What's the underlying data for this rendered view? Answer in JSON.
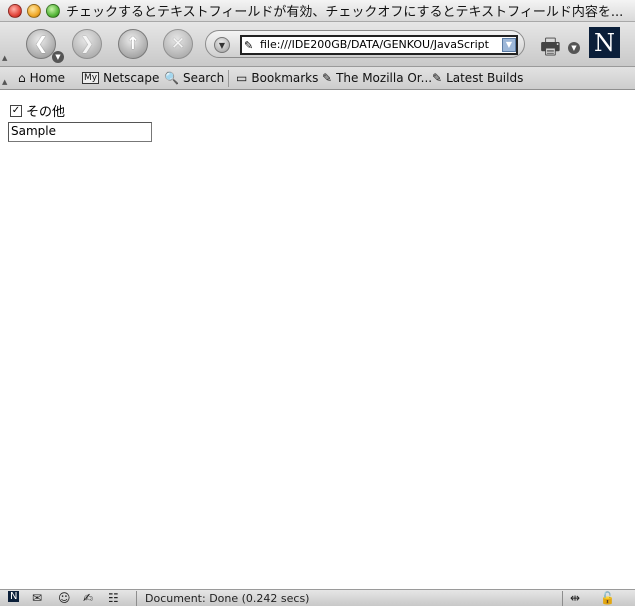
{
  "window": {
    "title": "チェックするとテキストフィールドが有効、チェックオフにするとテキストフィールド内容を..."
  },
  "navbar": {
    "back_icon": "back-arrow-icon",
    "forward_icon": "forward-arrow-icon",
    "reload_icon": "reload-icon",
    "stop_icon": "stop-icon",
    "url": "file:///IDE200GB/DATA/GENKOU/JavaScript"
  },
  "personal_toolbar": {
    "home": "Home",
    "netscape_badge": "My",
    "netscape": "Netscape",
    "search": "Search",
    "bookmarks": "Bookmarks",
    "mozilla": "The Mozilla Or...",
    "latest": "Latest Builds"
  },
  "content": {
    "checkbox_label": "その他",
    "checkbox_checked": true,
    "text_value": "Sample"
  },
  "statusbar": {
    "text": "Document: Done (0.242 secs)"
  }
}
